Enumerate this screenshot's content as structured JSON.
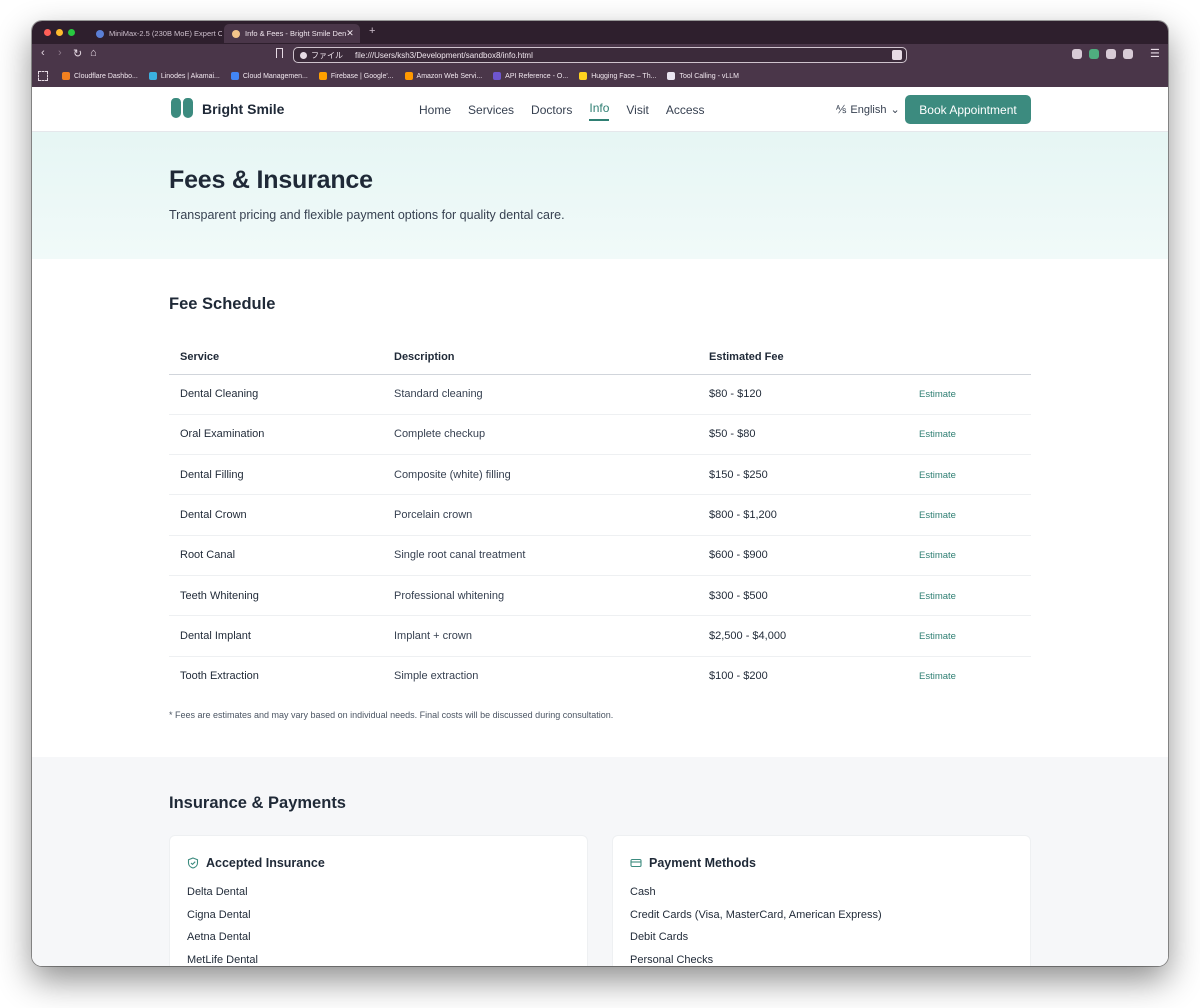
{
  "browser": {
    "tabs": [
      {
        "title": "MiniMax-2.5 (230B MoE) Expert O",
        "active": false
      },
      {
        "title": "Info & Fees - Bright Smile Den",
        "active": true
      }
    ],
    "new_tab": "+",
    "address_label": "ファイル",
    "url": "file:///Users/ksh3/Development/sandbox8/info.html",
    "bookmarks": [
      "Cloudflare Dashbo...",
      "Linodes | Akamai...",
      "Cloud Managemen...",
      "Firebase | Google'...",
      "Amazon Web Servi...",
      "API Reference - O...",
      "Hugging Face – Th...",
      "Tool Calling - vLLM"
    ]
  },
  "header": {
    "brand": "Bright Smile",
    "nav": [
      "Home",
      "Services",
      "Doctors",
      "Info",
      "Visit",
      "Access"
    ],
    "active_nav": "Info",
    "language": "English",
    "book_button": "Book Appointment"
  },
  "hero": {
    "title": "Fees & Insurance",
    "subtitle": "Transparent pricing and flexible payment options for quality dental care."
  },
  "fees": {
    "title": "Fee Schedule",
    "columns": [
      "Service",
      "Description",
      "Estimated Fee"
    ],
    "rows": [
      {
        "service": "Dental Cleaning",
        "description": "Standard cleaning",
        "fee": "$80 - $120",
        "action": "Estimate"
      },
      {
        "service": "Oral Examination",
        "description": "Complete checkup",
        "fee": "$50 - $80",
        "action": "Estimate"
      },
      {
        "service": "Dental Filling",
        "description": "Composite (white) filling",
        "fee": "$150 - $250",
        "action": "Estimate"
      },
      {
        "service": "Dental Crown",
        "description": "Porcelain crown",
        "fee": "$800 - $1,200",
        "action": "Estimate"
      },
      {
        "service": "Root Canal",
        "description": "Single root canal treatment",
        "fee": "$600 - $900",
        "action": "Estimate"
      },
      {
        "service": "Teeth Whitening",
        "description": "Professional whitening",
        "fee": "$300 - $500",
        "action": "Estimate"
      },
      {
        "service": "Dental Implant",
        "description": "Implant + crown",
        "fee": "$2,500 - $4,000",
        "action": "Estimate"
      },
      {
        "service": "Tooth Extraction",
        "description": "Simple extraction",
        "fee": "$100 - $200",
        "action": "Estimate"
      }
    ],
    "note": "* Fees are estimates and may vary based on individual needs. Final costs will be discussed during consultation."
  },
  "insurance": {
    "title": "Insurance & Payments",
    "accepted": {
      "title": "Accepted Insurance",
      "icon": "shield-check-icon",
      "items": [
        "Delta Dental",
        "Cigna Dental",
        "Aetna Dental",
        "MetLife Dental"
      ]
    },
    "payment": {
      "title": "Payment Methods",
      "icon": "credit-card-icon",
      "items": [
        "Cash",
        "Credit Cards (Visa, MasterCard, American Express)",
        "Debit Cards",
        "Personal Checks"
      ]
    }
  },
  "colors": {
    "brand": "#3c8b7f",
    "accent_text": "#2f7f73",
    "browser_chrome": "#4a3649",
    "hero_bg": "#e6f6f4"
  }
}
